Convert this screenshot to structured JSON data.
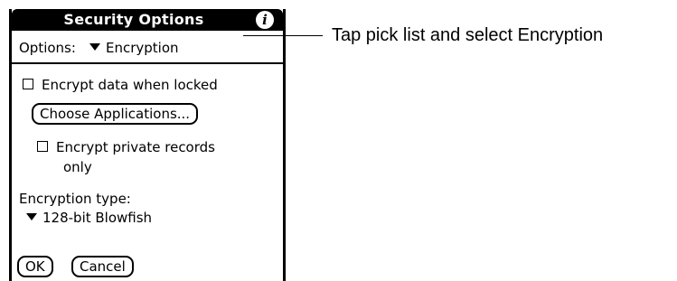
{
  "dialog": {
    "title": "Security Options",
    "info_icon": "i",
    "options_label": "Options:",
    "options_value": "Encryption",
    "encrypt_when_locked": {
      "label": "Encrypt data when locked",
      "checked": false
    },
    "choose_apps_label": "Choose Applications...",
    "encrypt_private": {
      "line1": "Encrypt private records",
      "line2": "only",
      "checked": false
    },
    "encryption_type_label": "Encryption type:",
    "encryption_type_value": "128-bit Blowfish",
    "ok_label": "OK",
    "cancel_label": "Cancel"
  },
  "callout": {
    "text": "Tap pick list and select Encryption"
  }
}
